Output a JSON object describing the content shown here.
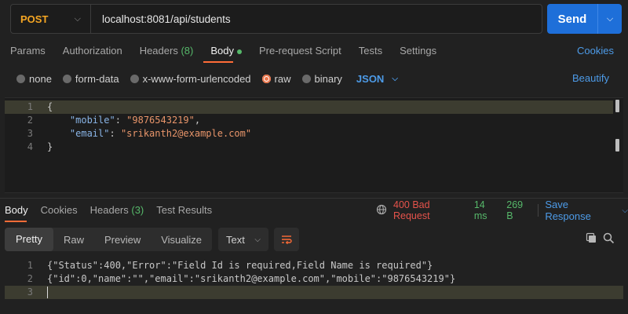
{
  "request": {
    "method": "POST",
    "url": "localhost:8081/api/students",
    "send_label": "Send"
  },
  "req_tabs": {
    "params": "Params",
    "authorization": "Authorization",
    "headers": "Headers",
    "headers_count": "(8)",
    "body": "Body",
    "prerequest": "Pre-request Script",
    "tests": "Tests",
    "settings": "Settings",
    "cookies": "Cookies"
  },
  "body_types": {
    "none": "none",
    "form_data": "form-data",
    "urlencoded": "x-www-form-urlencoded",
    "raw": "raw",
    "binary": "binary",
    "format": "JSON",
    "beautify": "Beautify"
  },
  "request_body": {
    "line_numbers": [
      "1",
      "2",
      "3",
      "4"
    ],
    "open_brace": "{",
    "mobile_key": "\"mobile\"",
    "mobile_value": "\"9876543219\"",
    "email_key": "\"email\"",
    "email_value": "\"srikanth2@example.com\"",
    "close_brace": "}"
  },
  "response_tabs": {
    "body": "Body",
    "cookies": "Cookies",
    "headers": "Headers",
    "headers_count": "(3)",
    "test_results": "Test Results"
  },
  "response_status": {
    "status": "400 Bad Request",
    "time": "14 ms",
    "size": "269 B",
    "save": "Save Response"
  },
  "view_modes": {
    "pretty": "Pretty",
    "raw": "Raw",
    "preview": "Preview",
    "visualize": "Visualize",
    "format": "Text"
  },
  "response_body": {
    "line_numbers": [
      "1",
      "2",
      "3"
    ],
    "line1": "{\"Status\":400,\"Error\":\"Field Id is required,Field Name is required\"}",
    "line2": "{\"id\":0,\"name\":\"\",\"email\":\"srikanth2@example.com\",\"mobile\":\"9876543219\"}",
    "line3": ""
  },
  "colors": {
    "method": "#f5a623",
    "send": "#1e6fd9",
    "accent": "#ff6c37",
    "status_error": "#e5534b",
    "success": "#56b86a",
    "link": "#4d9be8"
  }
}
